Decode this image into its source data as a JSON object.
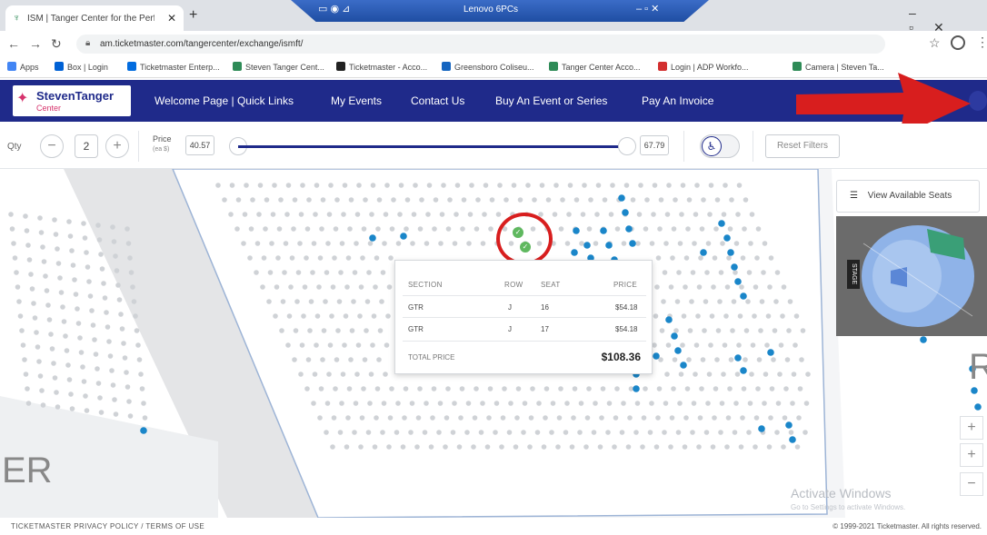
{
  "browser": {
    "tab_title": "ISM | Tanger Center for the Perfo",
    "url": "am.ticketmaster.com/tangercenter/exchange/ismft/",
    "remote_title": "Lenovo 6PCs",
    "bookmarks": [
      {
        "label": "Apps",
        "color": "#4285f4"
      },
      {
        "label": "Box | Login",
        "color": "#0061d5"
      },
      {
        "label": "Ticketmaster Enterp...",
        "color": "#026cdf"
      },
      {
        "label": "Steven Tanger Cent...",
        "color": "#2e8b57"
      },
      {
        "label": "Ticketmaster - Acco...",
        "color": "#222222"
      },
      {
        "label": "Greensboro Coliseu...",
        "color": "#1565c0"
      },
      {
        "label": "Tanger Center Acco...",
        "color": "#2e8b57"
      },
      {
        "label": "Login | ADP Workfo...",
        "color": "#d32f2f"
      },
      {
        "label": "Camera | Steven Ta...",
        "color": "#2e8b57"
      }
    ]
  },
  "site": {
    "logo_line1": "StevenTanger",
    "logo_line2": "Center",
    "nav": [
      "Welcome Page | Quick Links",
      "My Events",
      "Contact Us",
      "Buy An Event or Series",
      "Pay An Invoice"
    ]
  },
  "filters": {
    "qty_label": "Qty",
    "qty_value": "2",
    "price_label": "Price",
    "price_sub": "(ea $)",
    "price_min": "40.57",
    "price_max": "67.79",
    "reset_label": "Reset Filters"
  },
  "map": {
    "view_seats_label": "View Available Seats",
    "stage_label": "STAGE",
    "section_letter_left": "ER",
    "section_letter_right": "R",
    "watermark_title": "Activate Windows",
    "watermark_sub": "Go to Settings to activate Windows."
  },
  "popup": {
    "headers": [
      "SECTION",
      "ROW",
      "SEAT",
      "PRICE"
    ],
    "rows": [
      [
        "GTR",
        "J",
        "16",
        "$54.18"
      ],
      [
        "GTR",
        "J",
        "17",
        "$54.18"
      ]
    ],
    "total_label": "TOTAL PRICE",
    "total_value": "$108.36"
  },
  "footer": {
    "privacy": "TICKETMASTER PRIVACY POLICY  /  TERMS OF USE",
    "copyright": "© 1999-2021 Ticketmaster. All rights reserved."
  },
  "colors": {
    "nav_bg": "#1f2a8a",
    "available_seat": "#1a86c9",
    "unavailable_seat": "#cfd2d6",
    "annotation_red": "#d81e1e"
  }
}
